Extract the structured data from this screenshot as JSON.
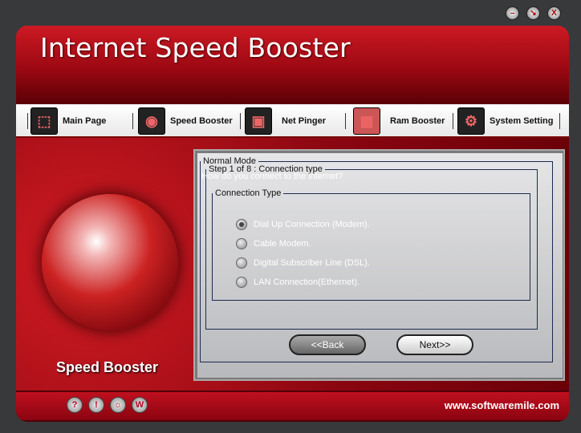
{
  "window_controls": {
    "minimize": "–",
    "restore": "↘",
    "close": "X"
  },
  "header": {
    "title": "Internet Speed Booster"
  },
  "nav": [
    {
      "label": "Main Page",
      "icon": "main-page-icon"
    },
    {
      "label": "Speed Booster",
      "icon": "speed-booster-icon"
    },
    {
      "label": "Net Pinger",
      "icon": "net-pinger-icon"
    },
    {
      "label": "Ram Booster",
      "icon": "ram-booster-icon"
    },
    {
      "label": "System Setting",
      "icon": "system-setting-icon"
    }
  ],
  "side": {
    "label": "Speed Booster"
  },
  "wizard": {
    "mode": "Normal Mode",
    "step": "Step 1 of 8 : Connection type",
    "question": "How do you connect to the internet?",
    "group": "Connection Type",
    "options": [
      "Dial Up Connection (Modem).",
      "Cable Modem.",
      "Digital  Subscriber Line (DSL).",
      "LAN Connection(Ethernet)."
    ],
    "selected_index": 0,
    "back": "<<Back",
    "next": "Next>>"
  },
  "footer": {
    "icons": [
      "?",
      "!",
      "☼",
      "W"
    ],
    "url": "www.softwaremile.com"
  }
}
